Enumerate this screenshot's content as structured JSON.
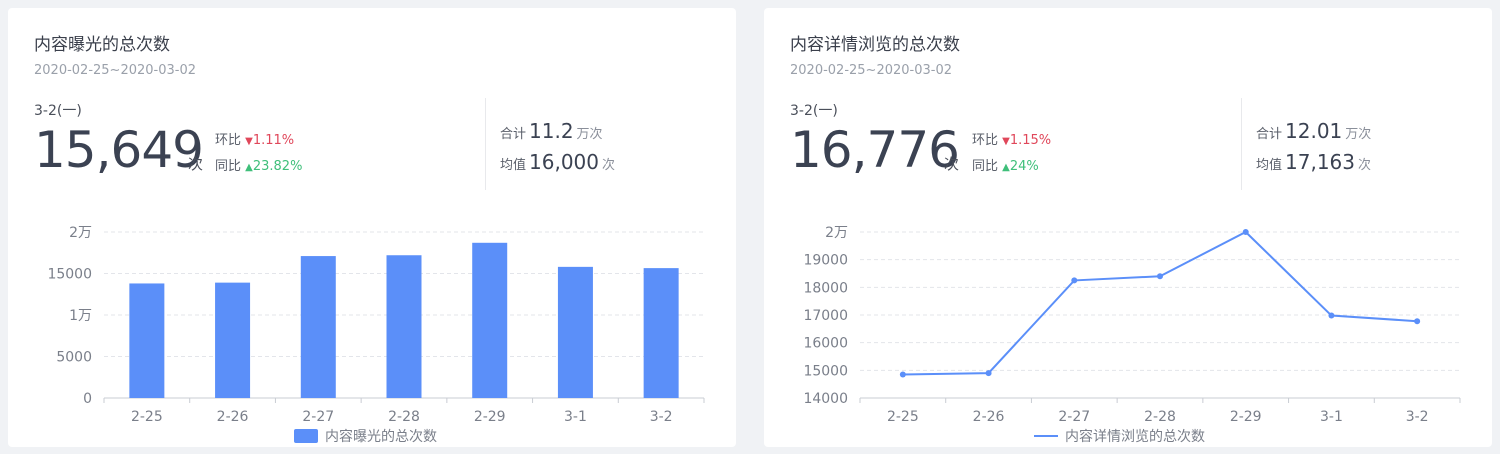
{
  "panels": [
    {
      "title": "内容曝光的总次数",
      "date_range": "2020-02-25~2020-03-02",
      "day_label": "3-2(一)",
      "value": "15,649",
      "unit": "次",
      "mom_label": "环比",
      "mom_value": "1.11%",
      "mom_direction": "down",
      "yoy_label": "同比",
      "yoy_value": "23.82%",
      "yoy_direction": "up",
      "total_label": "合计",
      "total_value": "11.2",
      "total_unit": "万次",
      "avg_label": "均值",
      "avg_value": "16,000",
      "avg_unit": "次"
    },
    {
      "title": "内容详情浏览的总次数",
      "date_range": "2020-02-25~2020-03-02",
      "day_label": "3-2(一)",
      "value": "16,776",
      "unit": "次",
      "mom_label": "环比",
      "mom_value": "1.15%",
      "mom_direction": "down",
      "yoy_label": "同比",
      "yoy_value": "24%",
      "yoy_direction": "up",
      "total_label": "合计",
      "total_value": "12.01",
      "total_unit": "万次",
      "avg_label": "均值",
      "avg_value": "17,163",
      "avg_unit": "次"
    }
  ],
  "chart_data": [
    {
      "type": "bar",
      "categories": [
        "2-25",
        "2-26",
        "2-27",
        "2-28",
        "2-29",
        "3-1",
        "3-2"
      ],
      "series": [
        {
          "name": "内容曝光的总次数",
          "values": [
            13800,
            13900,
            17100,
            17200,
            18700,
            15800,
            15649
          ]
        }
      ],
      "ylim": [
        0,
        20000
      ],
      "yticks": [
        0,
        5000,
        10000,
        15000,
        20000
      ],
      "ytick_labels": [
        "0",
        "5000",
        "1万",
        "15000",
        "2万"
      ],
      "legend": "bottom",
      "grid": true,
      "color": "#5b8ff9"
    },
    {
      "type": "line",
      "categories": [
        "2-25",
        "2-26",
        "2-27",
        "2-28",
        "2-29",
        "3-1",
        "3-2"
      ],
      "series": [
        {
          "name": "内容详情浏览的总次数",
          "values": [
            14850,
            14900,
            18250,
            18400,
            20000,
            16980,
            16776
          ]
        }
      ],
      "ylim": [
        14000,
        20000
      ],
      "yticks": [
        14000,
        15000,
        16000,
        17000,
        18000,
        19000,
        20000
      ],
      "ytick_labels": [
        "14000",
        "15000",
        "16000",
        "17000",
        "18000",
        "19000",
        "2万"
      ],
      "legend": "bottom",
      "grid": true,
      "color": "#5b8ff9"
    }
  ]
}
